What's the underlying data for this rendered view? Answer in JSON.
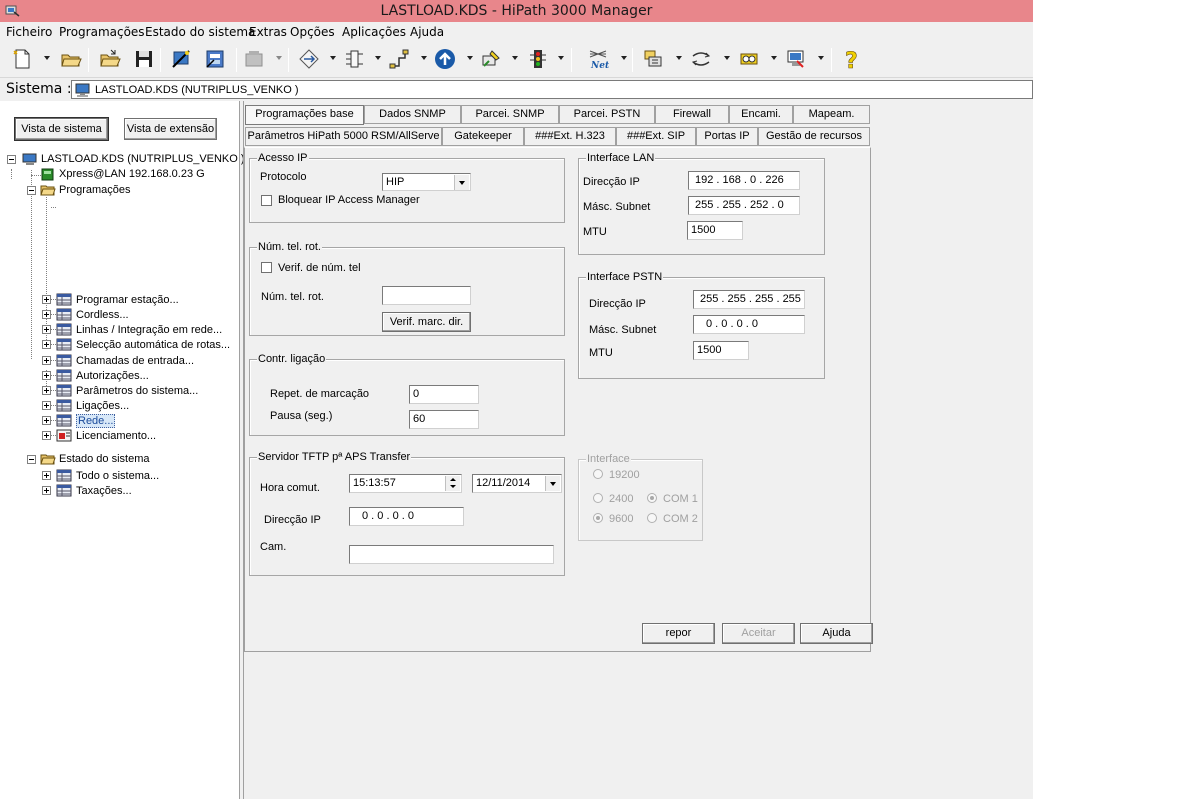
{
  "window": {
    "title": "LASTLOAD.KDS - HiPath 3000 Manager"
  },
  "menu": [
    "Ficheiro",
    "Programações",
    "Estado do sistema",
    "Extras",
    "Opções",
    "Aplicações",
    "Ajuda"
  ],
  "toolbar": {
    "icons": [
      "new-file-icon",
      "open-folder-icon",
      "open-file-icon",
      "save-icon",
      "wizard-icon",
      "config-icon",
      "stations-icon",
      "transfer-icon",
      "expert-icon",
      "network-icon",
      "cli-icon",
      "phone-icon",
      "traffic-light-icon",
      "net-icon",
      "users-icon",
      "connect-icon",
      "book-icon",
      "monitor-icon",
      "help-icon"
    ]
  },
  "system": {
    "label": "Sistema :",
    "value": "LASTLOAD.KDS (NUTRIPLUS_VENKO )"
  },
  "left": {
    "view_system": "Vista de sistema",
    "view_extension": "Vista de extensão",
    "tree": {
      "root": "LASTLOAD.KDS (NUTRIPLUS_VENKO )",
      "xpress": "Xpress@LAN  192.168.0.23 G",
      "programacoes": "Programações",
      "prog_items": [
        "Programar estação...",
        "Cordless...",
        "Linhas / Integração em rede...",
        "Selecção automática de rotas...",
        "Chamadas de entrada...",
        "Autorizações...",
        "Parâmetros do sistema...",
        "Ligações...",
        "Rede...",
        "Licenciamento..."
      ],
      "estado": "Estado do sistema",
      "estado_items": [
        "Todo o sistema...",
        "Taxações..."
      ]
    }
  },
  "tabs_row1": [
    "Programações base",
    "Dados SNMP",
    "Parcei. SNMP",
    "Parcei. PSTN",
    "Firewall",
    "Encami.",
    "Mapeam."
  ],
  "tabs_row2": [
    "Parâmetros HiPath 5000 RSM/AllServe",
    "Gatekeeper",
    "###Ext. H.323",
    "###Ext. SIP",
    "Portas IP",
    "Gestão de recursos"
  ],
  "acesso_ip": {
    "title": "Acesso IP",
    "protocol_label": "Protocolo",
    "protocol_value": "HIP",
    "block_label": "Bloquear IP Access Manager"
  },
  "num_tel": {
    "title": "Núm. tel. rot.",
    "verif_label": "Verif. de núm. tel",
    "num_label": "Núm. tel. rot.",
    "num_value": "",
    "button": "Verif. marc. dir."
  },
  "contr": {
    "title": "Contr. ligação",
    "repet_label": "Repet. de marcação",
    "repet_value": "0",
    "pausa_label": "Pausa (seg.)",
    "pausa_value": "60"
  },
  "tftp": {
    "title": "Servidor TFTP pª APS Transfer",
    "hora_label": "Hora comut.",
    "hora_value": "15:13:57",
    "date_value": "12/11/2014",
    "ip_label": "Direcção IP",
    "ip_value": "0  .  0  .  0  .  0",
    "cam_label": "Cam.",
    "cam_value": ""
  },
  "lan": {
    "title": "Interface LAN",
    "ip_label": "Direcção IP",
    "ip_value": "192 . 168 .  0  . 226",
    "mask_label": "Másc. Subnet",
    "mask_value": "255 . 255 . 252 .  0",
    "mtu_label": "MTU",
    "mtu_value": "1500"
  },
  "pstn": {
    "title": "Interface PSTN",
    "ip_label": "Direcção IP",
    "ip_value": "255 . 255 . 255 . 255",
    "mask_label": "Másc. Subnet",
    "mask_value": "0  .  0  .  0  .  0",
    "mtu_label": "MTU",
    "mtu_value": "1500"
  },
  "interface": {
    "title": "Interface",
    "opt_19200": "19200",
    "opt_2400": "2400",
    "opt_9600": "9600",
    "opt_com1": "COM 1",
    "opt_com2": "COM 2"
  },
  "buttons": {
    "reset": "repor",
    "accept": "Aceitar",
    "help": "Ajuda"
  }
}
